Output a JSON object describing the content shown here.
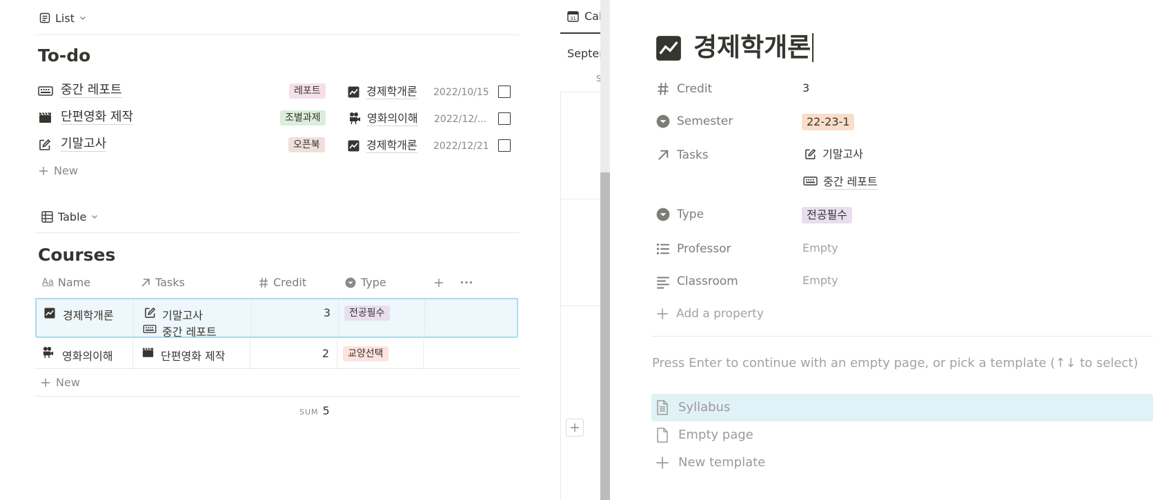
{
  "list_view": {
    "view_label": "List",
    "title": "To-do",
    "items": [
      {
        "name": "중간 레포트",
        "icon": "keyboard-icon",
        "tag": "레포트",
        "tag_color": "#f5e0e9",
        "course": "경제학개론",
        "course_icon": "chart-icon",
        "date": "2022/10/15"
      },
      {
        "name": "단편영화 제작",
        "icon": "clapperboard-icon",
        "tag": "조별과제",
        "tag_color": "#dbeddb",
        "course": "영화의이해",
        "course_icon": "film-camera-icon",
        "date": "2022/12/..."
      },
      {
        "name": "기말고사",
        "icon": "edit-icon",
        "tag": "오픈북",
        "tag_color": "#eee0da",
        "course": "경제학개론",
        "course_icon": "chart-icon",
        "date": "2022/12/21"
      }
    ],
    "new_label": "New"
  },
  "table_view": {
    "view_label": "Table",
    "title": "Courses",
    "columns": {
      "name": "Name",
      "tasks": "Tasks",
      "credit": "Credit",
      "type": "Type"
    },
    "rows": [
      {
        "name": "경제학개론",
        "tasks": [
          "기말고사",
          "중간 레포트"
        ],
        "credit": "3",
        "type": "전공필수",
        "type_color": "#e8deee"
      },
      {
        "name": "영화의이해",
        "tasks": [
          "단편영화 제작"
        ],
        "credit": "2",
        "type": "교양선택",
        "type_color": "#ffe2dd"
      }
    ],
    "new_label": "New",
    "sum_label": "SUM",
    "sum_value": "5"
  },
  "calendar_view": {
    "tab_label": "Cal",
    "month_label": "Septer",
    "weekday_label": "S"
  },
  "page_panel": {
    "title": "경제학개론",
    "properties": {
      "credit_label": "Credit",
      "credit_value": "3",
      "semester_label": "Semester",
      "semester_value": "22-23-1",
      "semester_color": "#fadec9",
      "tasks_label": "Tasks",
      "tasks": [
        "기말고사",
        "중간 레포트"
      ],
      "type_label": "Type",
      "type_value": "전공필수",
      "type_color": "#e8deee",
      "professor_label": "Professor",
      "professor_value": "Empty",
      "classroom_label": "Classroom",
      "classroom_value": "Empty"
    },
    "add_property_label": "Add a property",
    "hint": "Press Enter to continue with an empty page, or pick a template (↑↓ to select)",
    "templates": [
      "Syllabus",
      "Empty page"
    ],
    "new_template_label": "New template"
  },
  "colors": {
    "accent": "#2eaadc",
    "selected_row_bg": "#eef7fb",
    "template_highlight": "#e1f1f8"
  }
}
